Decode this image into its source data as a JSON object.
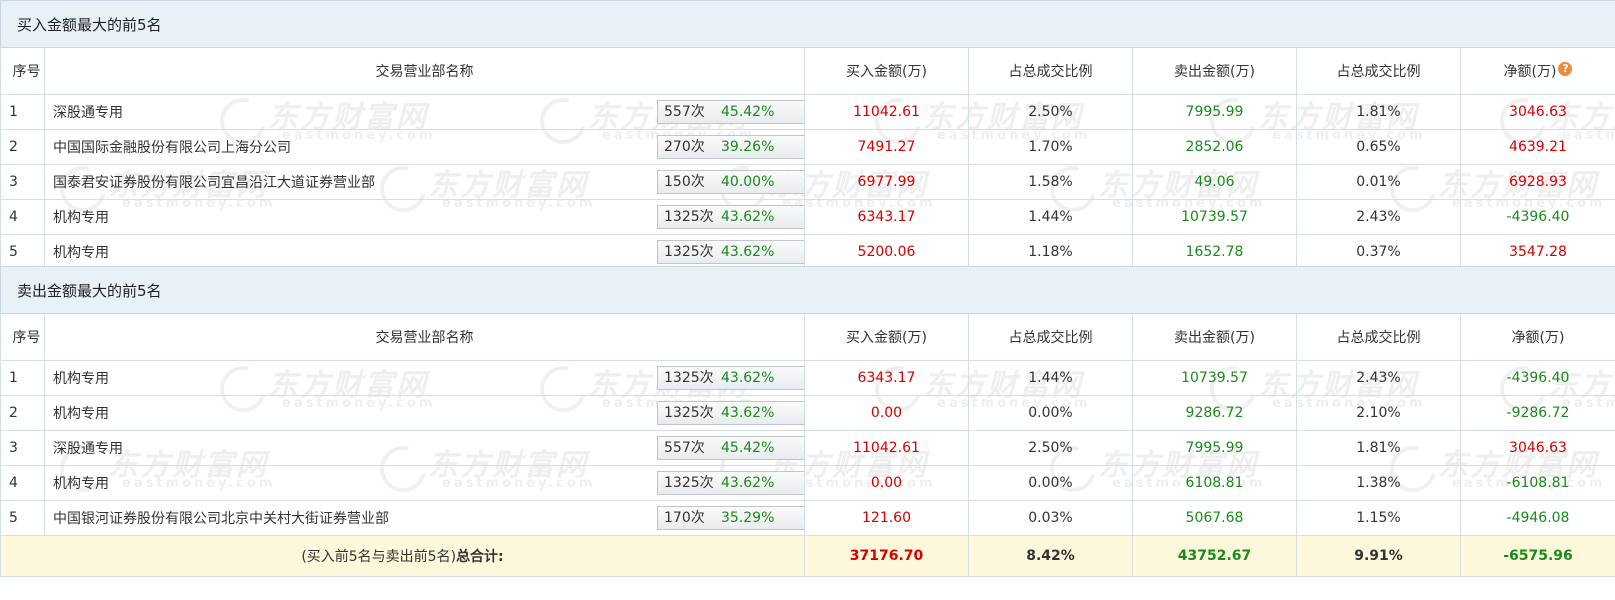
{
  "watermark": {
    "cn": "东方财富网",
    "en": "eastmoney.com"
  },
  "columns": {
    "idx": "序号",
    "name": "交易营业部名称",
    "buy": "买入金额(万)",
    "buy_pct": "占总成交比例",
    "sell": "卖出金额(万)",
    "sell_pct": "占总成交比例",
    "net": "净额(万)"
  },
  "buy_section": {
    "title": "买入金额最大的前5名",
    "rows": [
      {
        "idx": "1",
        "name": "深股通专用",
        "times": "557次",
        "pct": "45.42%",
        "btn": "help",
        "buy": "11042.61",
        "buy_pct": "2.50%",
        "sell": "7995.99",
        "sell_pct": "1.81%",
        "net": "3046.63"
      },
      {
        "idx": "2",
        "name": "中国国际金融股份有限公司上海分公司",
        "times": "270次",
        "pct": "39.26%",
        "btn": "arrow",
        "buy": "7491.27",
        "buy_pct": "1.70%",
        "sell": "2852.06",
        "sell_pct": "0.65%",
        "net": "4639.21"
      },
      {
        "idx": "3",
        "name": "国泰君安证券股份有限公司宜昌沿江大道证券营业部",
        "times": "150次",
        "pct": "40.00%",
        "btn": "arrow",
        "buy": "6977.99",
        "buy_pct": "1.58%",
        "sell": "49.06",
        "sell_pct": "0.01%",
        "net": "6928.93"
      },
      {
        "idx": "4",
        "name": "机构专用",
        "times": "1325次",
        "pct": "43.62%",
        "btn": "arrow",
        "buy": "6343.17",
        "buy_pct": "1.44%",
        "sell": "10739.57",
        "sell_pct": "2.43%",
        "net": "-4396.40"
      },
      {
        "idx": "5",
        "name": "机构专用",
        "times": "1325次",
        "pct": "43.62%",
        "btn": "arrow",
        "buy": "5200.06",
        "buy_pct": "1.18%",
        "sell": "1652.78",
        "sell_pct": "0.37%",
        "net": "3547.28"
      }
    ]
  },
  "sell_section": {
    "title": "卖出金额最大的前5名",
    "rows": [
      {
        "idx": "1",
        "name": "机构专用",
        "times": "1325次",
        "pct": "43.62%",
        "btn": "help",
        "buy": "6343.17",
        "buy_pct": "1.44%",
        "sell": "10739.57",
        "sell_pct": "2.43%",
        "net": "-4396.40"
      },
      {
        "idx": "2",
        "name": "机构专用",
        "times": "1325次",
        "pct": "43.62%",
        "btn": "arrow",
        "buy": "0.00",
        "buy_pct": "0.00%",
        "sell": "9286.72",
        "sell_pct": "2.10%",
        "net": "-9286.72"
      },
      {
        "idx": "3",
        "name": "深股通专用",
        "times": "557次",
        "pct": "45.42%",
        "btn": "arrow",
        "buy": "11042.61",
        "buy_pct": "2.50%",
        "sell": "7995.99",
        "sell_pct": "1.81%",
        "net": "3046.63"
      },
      {
        "idx": "4",
        "name": "机构专用",
        "times": "1325次",
        "pct": "43.62%",
        "btn": "arrow",
        "buy": "0.00",
        "buy_pct": "0.00%",
        "sell": "6108.81",
        "sell_pct": "1.38%",
        "net": "-6108.81"
      },
      {
        "idx": "5",
        "name": "中国银河证券股份有限公司北京中关村大街证券营业部",
        "times": "170次",
        "pct": "35.29%",
        "btn": "arrow",
        "buy": "121.60",
        "buy_pct": "0.03%",
        "sell": "5067.68",
        "sell_pct": "1.15%",
        "net": "-4946.08"
      }
    ]
  },
  "total": {
    "label_prefix": "(买入前5名与卖出前5名)",
    "label_bold": "总合计:",
    "buy": "37176.70",
    "buy_pct": "8.42%",
    "sell": "43752.67",
    "sell_pct": "9.91%",
    "net": "-6575.96"
  }
}
